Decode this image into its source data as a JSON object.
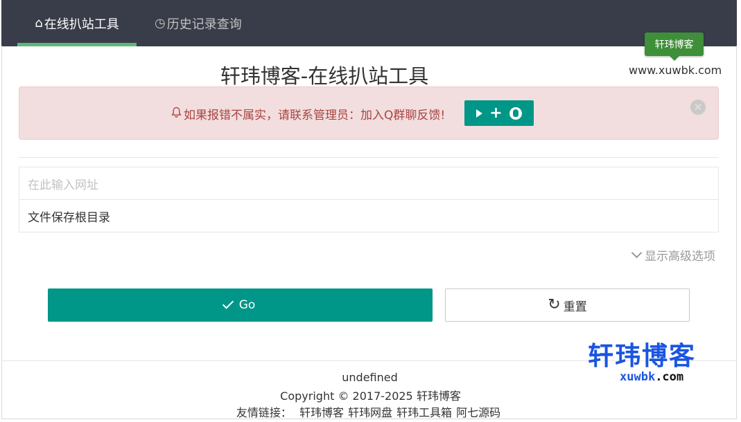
{
  "nav": {
    "tabs": [
      {
        "icon": "home-icon",
        "label": "在线扒站工具",
        "active": true
      },
      {
        "icon": "clock-icon",
        "label": "历史记录查询",
        "active": false
      }
    ]
  },
  "tooltip": "轩玮博客",
  "site_url": "www.xuwbk.com",
  "page_title": "轩玮博客-在线扒站工具",
  "alert": {
    "text": "如果报错不属实，请联系管理员：加入Q群聊反馈!",
    "button_icons": [
      "play-icon",
      "plus-icon",
      "qq-icon"
    ],
    "close_icon": "close-icon"
  },
  "form": {
    "url_placeholder": "在此输入网址",
    "dir_value": "文件保存根目录",
    "advanced_label": "显示高级选项"
  },
  "buttons": {
    "go_label": "Go",
    "reset_label": "重置"
  },
  "footer": {
    "line1": "undefined",
    "copyright": "Copyright © 2017-2025 轩玮博客",
    "links_label": "友情链接：",
    "links": [
      "轩玮博客",
      "轩玮网盘",
      "轩玮工具箱",
      "阿七源码"
    ]
  },
  "watermark": {
    "cn": "轩玮博客",
    "en": "xuwbk",
    "suffix": ".com"
  },
  "colors": {
    "nav_bg": "#393d49",
    "accent": "#009688",
    "active_underline": "#5fb878",
    "alert_bg": "#f2dede",
    "alert_text": "#a94442",
    "tooltip_bg": "#3f8f3a"
  }
}
